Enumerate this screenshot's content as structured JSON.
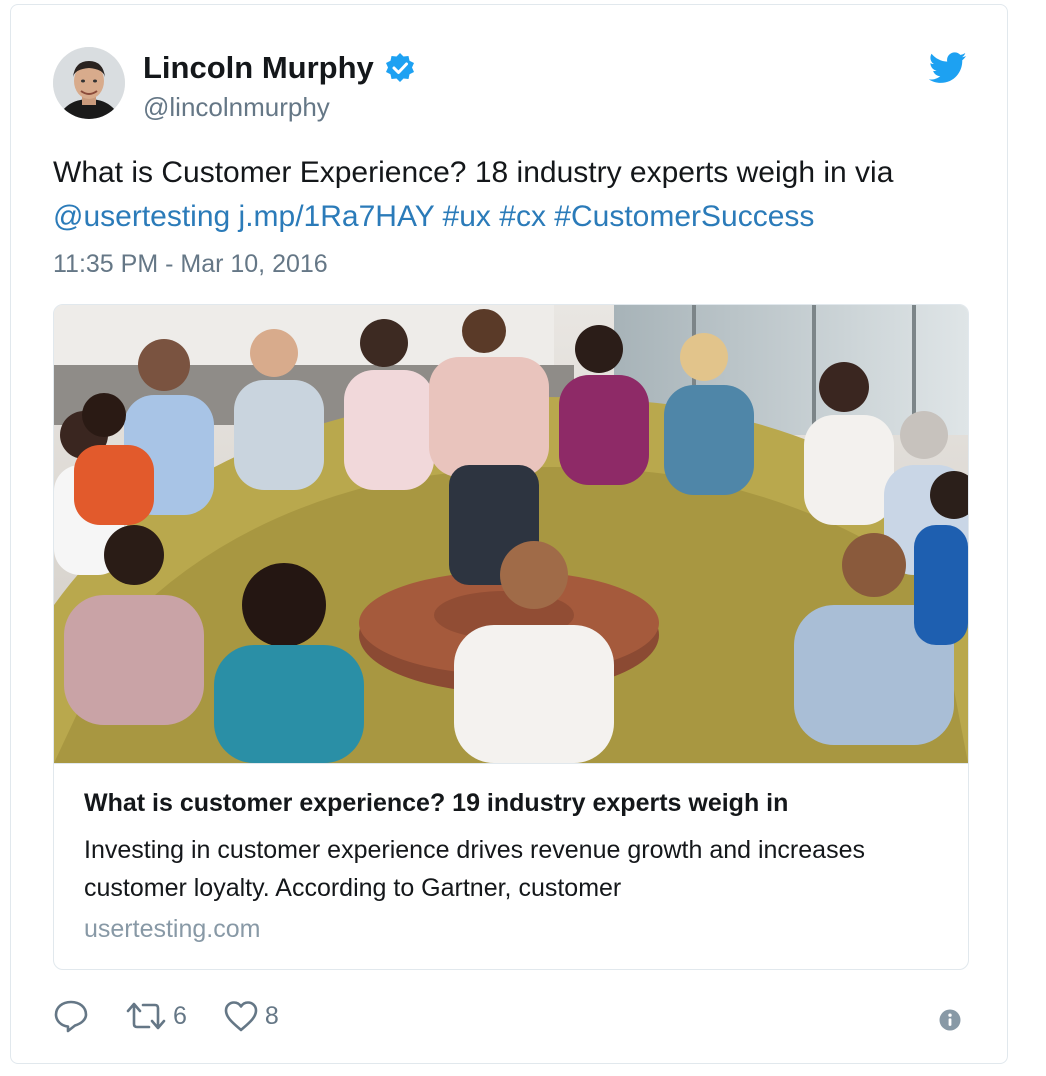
{
  "author": {
    "display_name": "Lincoln Murphy",
    "handle": "@lincolnmurphy",
    "verified": true,
    "avatar_icon": "user-avatar"
  },
  "tweet": {
    "text_plain": "What is Customer Experience? 18 industry experts weigh in via ",
    "mention": "@usertesting",
    "link": "j.mp/1Ra7HAY",
    "hashtags": [
      "#ux",
      "#cx",
      "#CustomerSuccess"
    ],
    "timestamp": "11:35 PM - Mar 10, 2016"
  },
  "card": {
    "image_icon": "group-meeting-photo",
    "title": "What is customer experience? 19 industry experts weigh in",
    "description": "Investing in customer experience drives revenue growth and increases customer loyalty. According to Gartner, customer",
    "domain": "usertesting.com"
  },
  "actions": {
    "reply_icon": "reply-icon",
    "retweet_count": "6",
    "like_count": "8"
  },
  "colors": {
    "link": "#2b7bb9",
    "twitter_blue": "#1da1f2",
    "muted": "#657786",
    "border": "#e1e8ed"
  }
}
